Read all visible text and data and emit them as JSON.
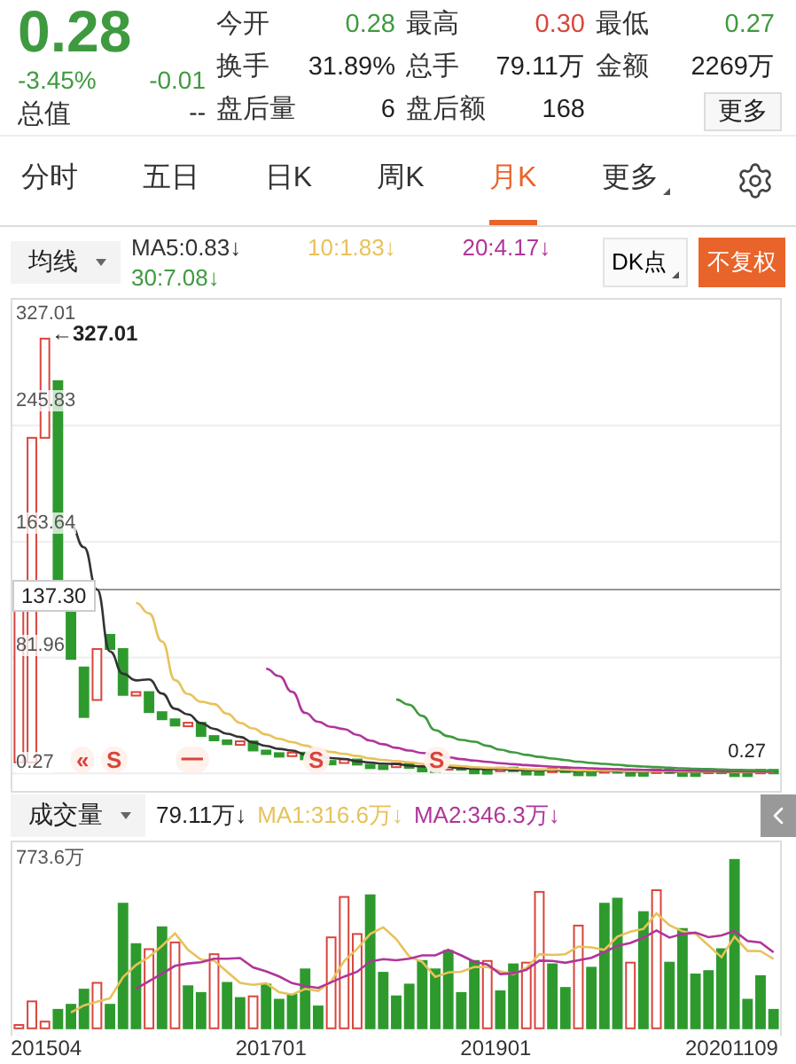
{
  "quote": {
    "price": "0.28",
    "change_pct": "-3.45%",
    "change": "-0.01",
    "color": "#3f9a3f",
    "market_cap": {
      "label": "总值",
      "value": "--"
    },
    "stats": [
      {
        "label": "今开",
        "value": "0.28",
        "color": "#3f9a3f"
      },
      {
        "label": "最高",
        "value": "0.30",
        "color": "#d8453c"
      },
      {
        "label": "最低",
        "value": "0.27",
        "color": "#3f9a3f"
      },
      {
        "label": "换手",
        "value": "31.89%",
        "color": "#222222"
      },
      {
        "label": "总手",
        "value": "79.11万",
        "color": "#222222"
      },
      {
        "label": "金额",
        "value": "2269万",
        "color": "#222222"
      },
      {
        "label": "盘后量",
        "value": "6",
        "color": "#222222"
      },
      {
        "label": "盘后额",
        "value": "168",
        "color": "#222222"
      }
    ],
    "more_button": "更多"
  },
  "tabs": [
    {
      "label": "分时",
      "selected": false
    },
    {
      "label": "五日",
      "selected": false
    },
    {
      "label": "日K",
      "selected": false
    },
    {
      "label": "周K",
      "selected": false
    },
    {
      "label": "月K",
      "selected": true
    },
    {
      "label": "更多",
      "selected": false,
      "dropdown": true
    }
  ],
  "ma_bar": {
    "selector": "均线",
    "legend": [
      {
        "label": "MA5:0.83↓",
        "color": "#333333"
      },
      {
        "label": "10:1.83↓",
        "color": "#e8c25a"
      },
      {
        "label": "20:4.17↓",
        "color": "#b0359a"
      },
      {
        "label": "30:7.08↓",
        "color": "#3f9a3f"
      }
    ],
    "dk_button": "DK点",
    "adjust_button": "不复权"
  },
  "price_chart": {
    "y_labels": [
      "327.01",
      "245.83",
      "163.64",
      "81.96",
      "0.27"
    ],
    "max_marker": "←327.01",
    "min_marker": "0.27",
    "crosshair_label": "137.30",
    "signals": [
      {
        "label": "«"
      },
      {
        "label": "S"
      },
      {
        "label": "一"
      },
      {
        "label": "S"
      },
      {
        "label": "S"
      }
    ]
  },
  "volume": {
    "selector": "成交量",
    "value": "79.11万↓",
    "legend": [
      {
        "label": "MA1:316.6万↓",
        "color": "#e8c25a"
      },
      {
        "label": "MA2:346.3万↓",
        "color": "#b0359a"
      }
    ],
    "y_label": "773.6万",
    "x_labels": [
      "201504",
      "201701",
      "201901",
      "20201109"
    ]
  }
}
